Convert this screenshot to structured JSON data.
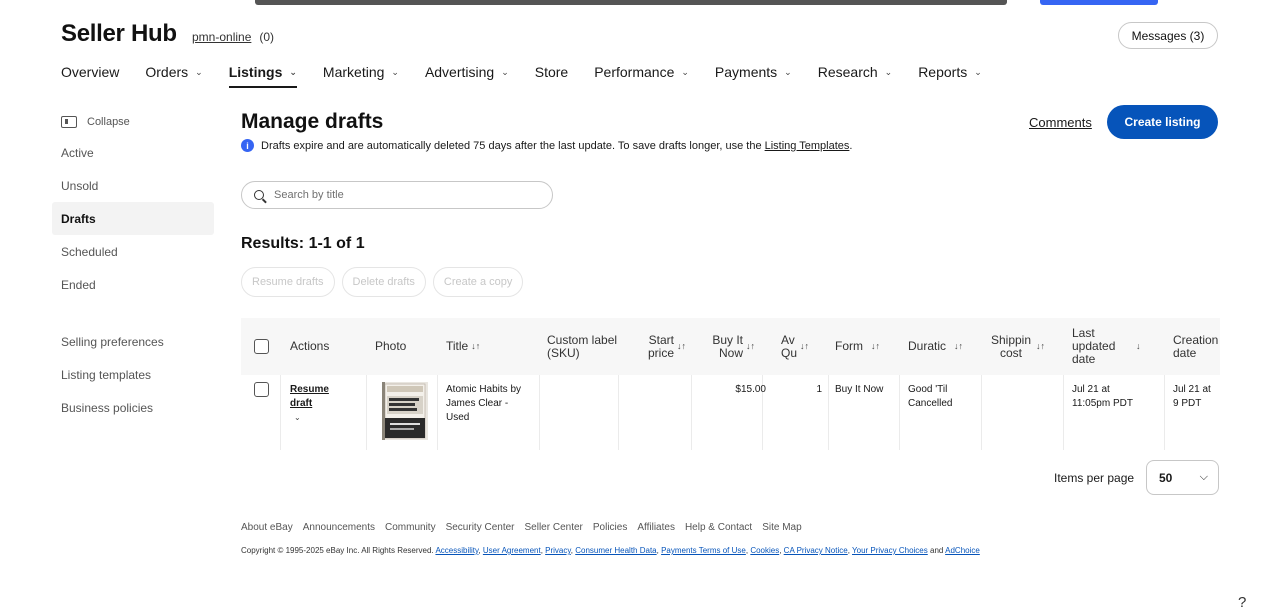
{
  "header": {
    "brand": "Seller Hub",
    "username": "pmn-online",
    "score": "(0)",
    "messages_label": "Messages (3)"
  },
  "nav": [
    {
      "label": "Overview",
      "dropdown": false
    },
    {
      "label": "Orders",
      "dropdown": true
    },
    {
      "label": "Listings",
      "dropdown": true,
      "active": true
    },
    {
      "label": "Marketing",
      "dropdown": true
    },
    {
      "label": "Advertising",
      "dropdown": true
    },
    {
      "label": "Store",
      "dropdown": false
    },
    {
      "label": "Performance",
      "dropdown": true
    },
    {
      "label": "Payments",
      "dropdown": true
    },
    {
      "label": "Research",
      "dropdown": true
    },
    {
      "label": "Reports",
      "dropdown": true
    }
  ],
  "sidebar": {
    "collapse_label": "Collapse",
    "items": [
      "Active",
      "Unsold",
      "Drafts",
      "Scheduled",
      "Ended"
    ],
    "active_item": "Drafts",
    "secondary_items": [
      "Selling preferences",
      "Listing templates",
      "Business policies"
    ]
  },
  "main": {
    "title": "Manage drafts",
    "info_text": "Drafts expire and are automatically deleted 75 days after the last update. To save drafts longer, use the",
    "info_link": "Listing Templates",
    "info_end": ".",
    "comments_label": "Comments",
    "create_listing_label": "Create listing",
    "search_placeholder": "Search by title",
    "results_label": "Results: 1-1 of 1",
    "bulk_actions": [
      "Resume drafts",
      "Delete drafts",
      "Create a copy"
    ]
  },
  "table": {
    "columns": [
      {
        "key": "actions",
        "label": "Actions"
      },
      {
        "key": "photo",
        "label": "Photo"
      },
      {
        "key": "title",
        "label": "Title"
      },
      {
        "key": "sku",
        "label": "Custom label (SKU)"
      },
      {
        "key": "start_price",
        "label": "Start price"
      },
      {
        "key": "buy_it_now",
        "label": "Buy It Now"
      },
      {
        "key": "avail_qty",
        "label": "Av Qu"
      },
      {
        "key": "format",
        "label": "Form"
      },
      {
        "key": "duration",
        "label": "Duratic"
      },
      {
        "key": "shipping",
        "label": "Shippin cost"
      },
      {
        "key": "last_updated",
        "label": "Last updated date"
      },
      {
        "key": "creation",
        "label": "Creation date"
      }
    ],
    "rows": [
      {
        "action_label": "Resume draft",
        "photo_alt": "Atomic Habits",
        "title": "Atomic Habits by James Clear - Used",
        "sku": "",
        "start_price": "",
        "buy_it_now": "$15.00",
        "avail_qty": "1",
        "format": "Buy It Now",
        "duration": "Good 'Til Cancelled",
        "shipping": "",
        "last_updated": "Jul 21 at 11:05pm PDT",
        "creation": "Jul 21 at 9 PDT"
      }
    ]
  },
  "pagination": {
    "items_per_page_label": "Items per page",
    "items_per_page_value": "50"
  },
  "footer": {
    "links": [
      "About eBay",
      "Announcements",
      "Community",
      "Security Center",
      "Seller Center",
      "Policies",
      "Affiliates",
      "Help & Contact",
      "Site Map"
    ],
    "copyright": "Copyright © 1995-2025 eBay Inc. All Rights Reserved.",
    "legal_links": [
      "Accessibility",
      "User Agreement",
      "Privacy",
      "Consumer Health Data",
      "Payments Terms of Use",
      "Cookies",
      "CA Privacy Notice",
      "Your Privacy Choices"
    ],
    "and_text": "and",
    "adchoice": "AdChoice"
  },
  "help_label": "?",
  "colors": {
    "accent": "#3665f3",
    "primary_button": "#0654ba",
    "text": "#191919"
  }
}
